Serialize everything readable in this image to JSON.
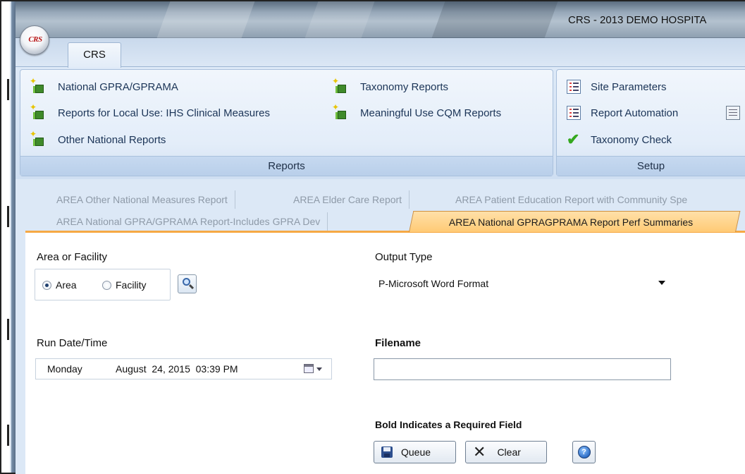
{
  "window": {
    "title": "CRS - 2013 DEMO HOSPITA",
    "orb_label": "CRS"
  },
  "ribbon": {
    "tab_label": "CRS",
    "groups": [
      {
        "label": "Reports",
        "items": [
          {
            "label": "National GPRA/GPRAMA",
            "icon": "report-book-icon"
          },
          {
            "label": "Reports for Local Use: IHS Clinical Measures",
            "icon": "report-book-icon"
          },
          {
            "label": "Other National Reports",
            "icon": "report-book-icon"
          },
          {
            "label": "Taxonomy Reports",
            "icon": "report-book-icon"
          },
          {
            "label": "Meaningful Use CQM Reports",
            "icon": "report-book-icon"
          }
        ]
      },
      {
        "label": "Setup",
        "items": [
          {
            "label": "Site Parameters",
            "icon": "list-icon"
          },
          {
            "label": "Report Automation",
            "icon": "list-icon"
          },
          {
            "label": "Taxonomy Check",
            "icon": "checkmark-icon"
          },
          {
            "label": "",
            "icon": "notepad-icon"
          }
        ]
      }
    ]
  },
  "doc_tabs": {
    "row1": [
      "AREA Other National Measures Report",
      "AREA Elder Care Report",
      "AREA Patient Education Report with Community Spe"
    ],
    "row2": [
      "AREA National GPRA/GPRAMA Report-Includes GPRA Dev",
      "AREA National GPRAGPRAMA Report Perf Summaries"
    ],
    "active_index": 1
  },
  "form": {
    "area_facility_label": "Area or Facility",
    "radio_area": "Area",
    "radio_facility": "Facility",
    "selected": "Area",
    "output_type_label": "Output Type",
    "output_type_value": "P-Microsoft Word Format",
    "run_datetime_label": "Run Date/Time",
    "run_day": "Monday",
    "run_date": "August  24, 2015  03:39 PM",
    "filename_label": "Filename",
    "filename_value": "",
    "required_note": "Bold Indicates a Required Field",
    "queue_label": "Queue",
    "clear_label": "Clear"
  },
  "colors": {
    "ribbon_bg": "#dce8f6",
    "active_tab": "#ffca75",
    "accent_text": "#1b3457"
  }
}
